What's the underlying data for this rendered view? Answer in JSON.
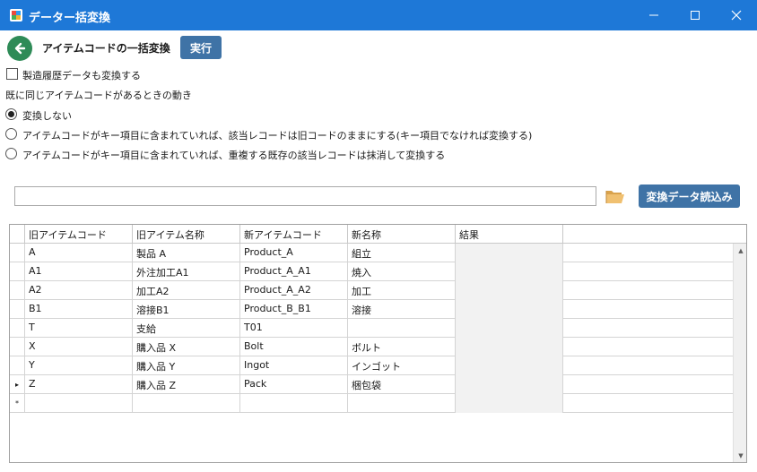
{
  "window": {
    "title": "データー括変換",
    "icon": "app-icon"
  },
  "toolbar": {
    "page_title": "アイテムコードの一括変換",
    "run_label": "実行"
  },
  "options": {
    "include_history_label": "製造履歴データも変換する",
    "include_history_checked": false,
    "duplicate_section_label": "既に同じアイテムコードがあるときの動き",
    "radios": [
      {
        "label": "変換しない",
        "checked": true
      },
      {
        "label": "アイテムコードがキー項目に含まれていれば、該当レコードは旧コードのままにする(キー項目でなければ変換する)",
        "checked": false
      },
      {
        "label": "アイテムコードがキー項目に含まれていれば、重複する既存の該当レコードは抹消して変換する",
        "checked": false
      }
    ]
  },
  "file": {
    "path_value": "",
    "load_label": "変換データ読込み"
  },
  "grid": {
    "columns": [
      "旧アイテムコード",
      "旧アイテム名称",
      "新アイテムコード",
      "新名称",
      "結果"
    ],
    "rows": [
      {
        "old_code": "A",
        "old_name": "製品 A",
        "new_code": "Product_A",
        "new_name": "組立",
        "result": ""
      },
      {
        "old_code": "A1",
        "old_name": "外注加工A1",
        "new_code": "Product_A_A1",
        "new_name": "焼入",
        "result": ""
      },
      {
        "old_code": "A2",
        "old_name": "加工A2",
        "new_code": "Product_A_A2",
        "new_name": "加工",
        "result": ""
      },
      {
        "old_code": "B1",
        "old_name": "溶接B1",
        "new_code": "Product_B_B1",
        "new_name": "溶接",
        "result": ""
      },
      {
        "old_code": "T",
        "old_name": "支給",
        "new_code": "T01",
        "new_name": "",
        "result": ""
      },
      {
        "old_code": "X",
        "old_name": "購入品 X",
        "new_code": "Bolt",
        "new_name": "ボルト",
        "result": ""
      },
      {
        "old_code": "Y",
        "old_name": "購入品 Y",
        "new_code": "Ingot",
        "new_name": "インゴット",
        "result": ""
      },
      {
        "old_code": "Z",
        "old_name": "購入品 Z",
        "new_code": "Pack",
        "new_name": "梱包袋",
        "result": ""
      }
    ],
    "current_row_marker": "▸",
    "new_row_marker": "*"
  }
}
